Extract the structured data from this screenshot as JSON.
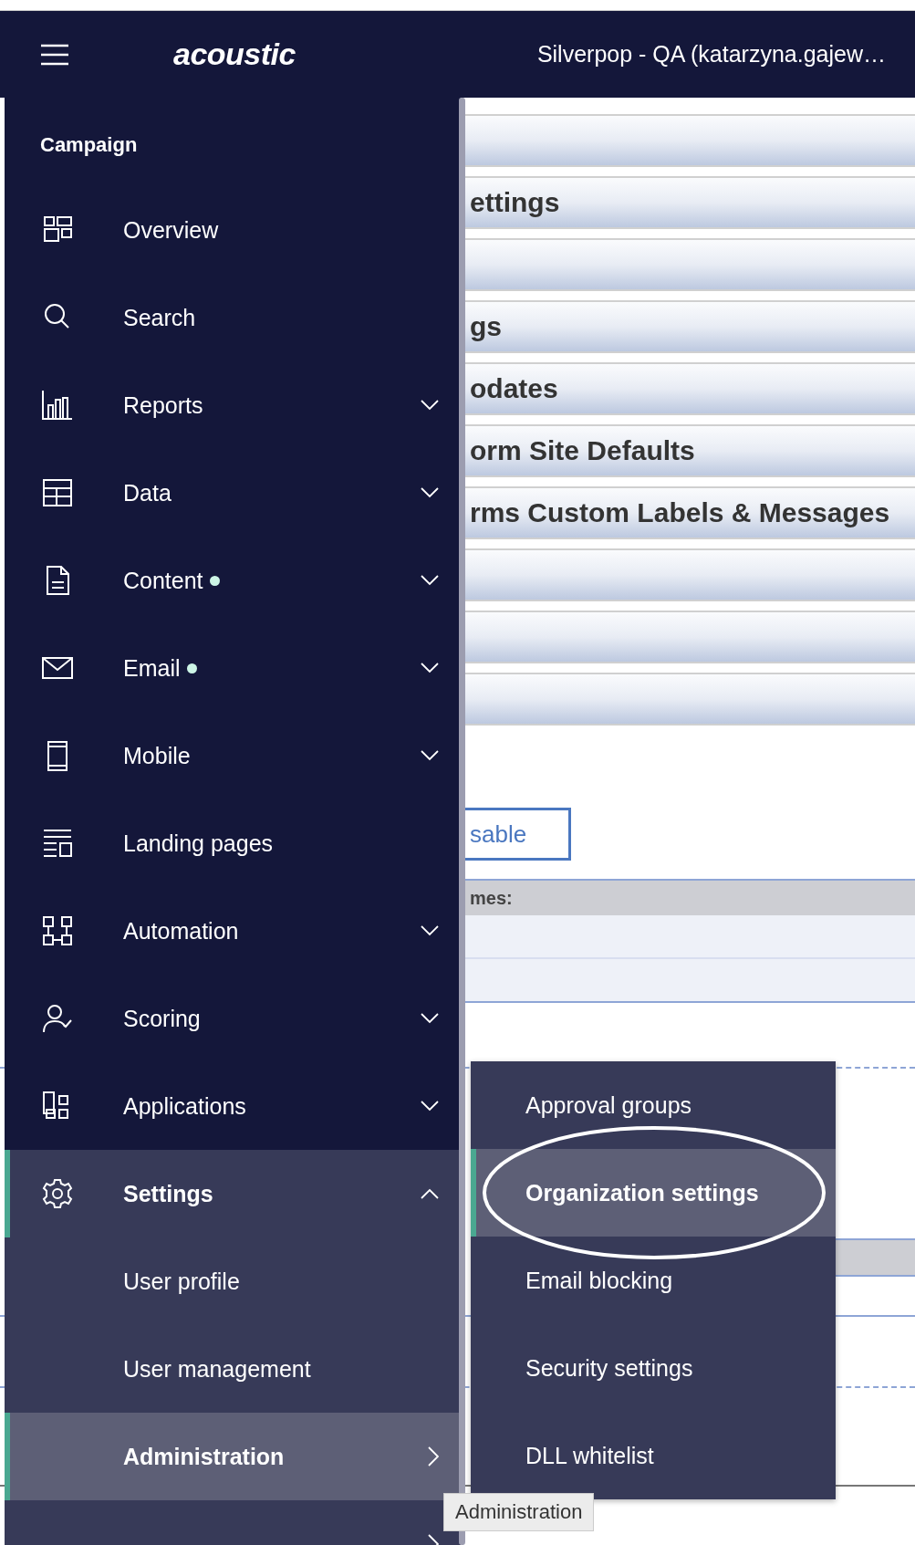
{
  "header": {
    "logo": "acoustic",
    "account": "Silverpop - QA (katarzyna.gajew…"
  },
  "background": {
    "bars": [
      {
        "kind": "blank"
      },
      {
        "kind": "titled",
        "title": "ettings"
      },
      {
        "kind": "blank"
      },
      {
        "kind": "titled",
        "title": "gs"
      },
      {
        "kind": "titled",
        "title": "odates"
      },
      {
        "kind": "titled",
        "title": "orm Site Defaults"
      },
      {
        "kind": "titled",
        "title": "rms Custom Labels & Messages"
      },
      {
        "kind": "blank"
      },
      {
        "kind": "blank"
      },
      {
        "kind": "blank"
      }
    ],
    "button": "sable",
    "table_header": "mes:"
  },
  "sidebar": {
    "section": "Campaign",
    "items": [
      {
        "label": "Overview",
        "kind": "link",
        "dot": false,
        "selected": false
      },
      {
        "label": "Search",
        "kind": "link",
        "dot": false,
        "selected": false
      },
      {
        "label": "Reports",
        "kind": "menu",
        "expanded": false,
        "dot": false,
        "selected": false
      },
      {
        "label": "Data",
        "kind": "menu",
        "expanded": false,
        "dot": false,
        "selected": false
      },
      {
        "label": "Content",
        "kind": "menu",
        "expanded": false,
        "dot": true,
        "selected": false
      },
      {
        "label": "Email",
        "kind": "menu",
        "expanded": false,
        "dot": true,
        "selected": false
      },
      {
        "label": "Mobile",
        "kind": "menu",
        "expanded": false,
        "dot": false,
        "selected": false
      },
      {
        "label": "Landing pages",
        "kind": "link",
        "dot": false,
        "selected": false
      },
      {
        "label": "Automation",
        "kind": "menu",
        "expanded": false,
        "dot": false,
        "selected": false
      },
      {
        "label": "Scoring",
        "kind": "menu",
        "expanded": false,
        "dot": false,
        "selected": false
      },
      {
        "label": "Applications",
        "kind": "menu",
        "expanded": false,
        "dot": false,
        "selected": false
      },
      {
        "label": "Settings",
        "kind": "menu",
        "expanded": true,
        "dot": false,
        "selected": true,
        "children": [
          {
            "label": "User profile",
            "kind": "link",
            "selected": false
          },
          {
            "label": "User management",
            "kind": "link",
            "selected": false
          },
          {
            "label": "Administration",
            "kind": "submenu",
            "selected": true
          },
          {
            "kind": "submenu",
            "selected": false
          }
        ]
      }
    ]
  },
  "flyout": {
    "items": [
      {
        "label": "Approval groups",
        "selected": false,
        "circled": false
      },
      {
        "label": "Organization settings",
        "selected": true,
        "circled": true
      },
      {
        "label": "Email blocking",
        "selected": false,
        "circled": false
      },
      {
        "label": "Security settings",
        "selected": false,
        "circled": false
      },
      {
        "label": "DLL whitelist",
        "selected": false,
        "circled": false
      }
    ]
  },
  "tooltip": {
    "text": "Administration"
  }
}
